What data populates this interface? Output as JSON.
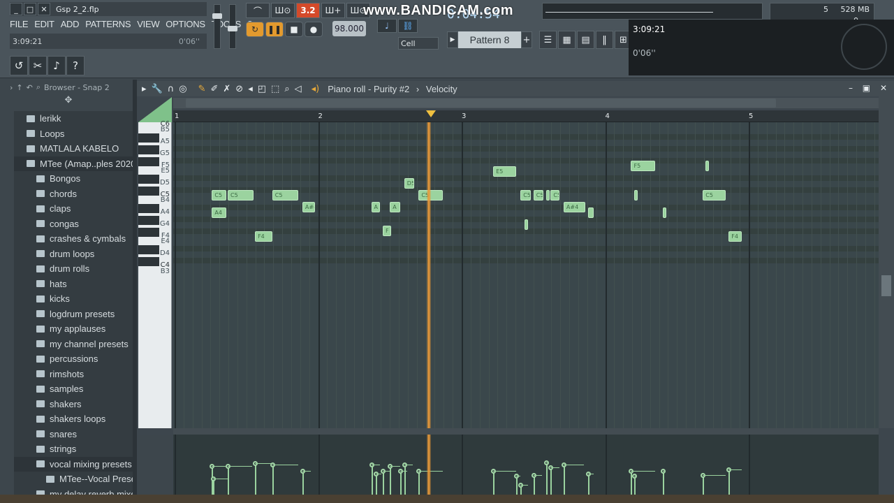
{
  "window": {
    "file_title": "Gsp 2_2.flp",
    "minimize_icon": "_",
    "restore_icon": "□",
    "close_icon": "✕"
  },
  "menu": [
    "FILE",
    "EDIT",
    "ADD",
    "PATTERNS",
    "VIEW",
    "OPTIONS",
    "TOOLS",
    "?"
  ],
  "hint": {
    "left": "3:09:21",
    "right": "0'06''"
  },
  "transport": {
    "buttons": [
      "⌒",
      "Ш⊙",
      "3.2",
      "Ш+",
      "Ш⊙",
      "↻",
      "❚❚",
      "■",
      "●"
    ],
    "tempo": "98.000",
    "time": "0:04:54"
  },
  "watermark": "www.BANDICAM.com",
  "snap": {
    "cell_label": "Cell"
  },
  "pattern": {
    "name": "Pattern 8",
    "prev_icon": "▶",
    "add_icon": "+"
  },
  "monitor": {
    "cpu": "5",
    "ram": "528 MB",
    "poly": "0"
  },
  "overlay": {
    "time": "3:09:21",
    "elapsed": "0'06''"
  },
  "browser": {
    "header": "Browser - Snap 2",
    "items": [
      {
        "label": "lerikk",
        "level": 1
      },
      {
        "label": "Loops",
        "level": 1
      },
      {
        "label": "MATLALA KABELO",
        "level": 1
      },
      {
        "label": "MTee (Amap..ples 2020",
        "level": 1,
        "selected": true
      },
      {
        "label": "Bongos",
        "level": 2
      },
      {
        "label": "chords",
        "level": 2
      },
      {
        "label": "claps",
        "level": 2
      },
      {
        "label": "congas",
        "level": 2
      },
      {
        "label": "crashes & cymbals",
        "level": 2
      },
      {
        "label": "drum loops",
        "level": 2
      },
      {
        "label": "drum rolls",
        "level": 2
      },
      {
        "label": "hats",
        "level": 2
      },
      {
        "label": "kicks",
        "level": 2
      },
      {
        "label": "logdrum presets",
        "level": 2
      },
      {
        "label": "my applauses",
        "level": 2
      },
      {
        "label": "my channel presets",
        "level": 2
      },
      {
        "label": "percussions",
        "level": 2
      },
      {
        "label": "rimshots",
        "level": 2
      },
      {
        "label": "samples",
        "level": 2
      },
      {
        "label": "shakers",
        "level": 2
      },
      {
        "label": "shakers loops",
        "level": 2
      },
      {
        "label": "snares",
        "level": 2
      },
      {
        "label": "strings",
        "level": 2
      },
      {
        "label": "vocal mixing presets",
        "level": 2,
        "selected": true
      },
      {
        "label": "MTee--Vocal Presets",
        "level": 3
      },
      {
        "label": "my delay reverb mixer",
        "level": 2
      }
    ]
  },
  "piano_roll": {
    "title": "Piano roll - Purity #2",
    "target": "Velocity",
    "bars": [
      "1",
      "2",
      "3",
      "4",
      "5"
    ],
    "key_labels": [
      "C6",
      "B5",
      "A5",
      "G5",
      "F5",
      "E5",
      "D5",
      "C5",
      "B4",
      "A4",
      "G4",
      "F4",
      "E4",
      "D4",
      "C4",
      "B3"
    ],
    "playhead_bar": 2.77,
    "colors": {
      "note": "#9bd39f",
      "playhead": "#e99a3a",
      "grid": "#3a474b"
    },
    "notes": [
      {
        "label": "C5",
        "key": "C5",
        "start": 1.26,
        "len": 0.1
      },
      {
        "label": "C5",
        "key": "C5",
        "start": 1.37,
        "len": 0.18
      },
      {
        "label": "C5",
        "key": "C5",
        "start": 1.68,
        "len": 0.18
      },
      {
        "label": "A4",
        "key": "A4",
        "start": 1.26,
        "len": 0.1
      },
      {
        "label": "F4",
        "key": "F4",
        "start": 1.56,
        "len": 0.12
      },
      {
        "label": "A#4",
        "key": "A#4",
        "start": 1.89,
        "len": 0.09
      },
      {
        "label": "A",
        "key": "A#4",
        "start": 2.37,
        "len": 0.06
      },
      {
        "label": "A",
        "key": "A#4",
        "start": 2.5,
        "len": 0.07
      },
      {
        "label": "F",
        "key": "F#4",
        "start": 2.45,
        "len": 0.06
      },
      {
        "label": "D5",
        "key": "D5",
        "start": 2.6,
        "len": 0.07
      },
      {
        "label": "C5",
        "key": "C5",
        "start": 2.7,
        "len": 0.17
      },
      {
        "label": "E5",
        "key": "E5",
        "start": 3.22,
        "len": 0.16
      },
      {
        "label": "C5",
        "key": "C5",
        "start": 3.41,
        "len": 0.07
      },
      {
        "label": "C5",
        "key": "C5",
        "start": 3.5,
        "len": 0.07
      },
      {
        "label": "",
        "key": "C5",
        "start": 3.59,
        "len": 0.02
      },
      {
        "label": "C5",
        "key": "C5",
        "start": 3.62,
        "len": 0.06
      },
      {
        "label": "",
        "key": "G4",
        "start": 3.44,
        "len": 0.02
      },
      {
        "label": "A#4",
        "key": "A#4",
        "start": 3.71,
        "len": 0.15
      },
      {
        "label": "",
        "key": "A4",
        "start": 3.88,
        "len": 0.04
      },
      {
        "label": "",
        "key": "C5",
        "start": 4.2,
        "len": 0.02
      },
      {
        "label": "F5",
        "key": "F5",
        "start": 4.18,
        "len": 0.17
      },
      {
        "label": "",
        "key": "A4",
        "start": 4.4,
        "len": 0.02
      },
      {
        "label": "",
        "key": "F5",
        "start": 4.7,
        "len": 0.01
      },
      {
        "label": "C5",
        "key": "C5",
        "start": 4.68,
        "len": 0.16
      },
      {
        "label": "F4",
        "key": "F4",
        "start": 4.86,
        "len": 0.09
      }
    ],
    "velocities": [
      {
        "pos": 1.26,
        "level": 0.5,
        "len": 0.1
      },
      {
        "pos": 1.27,
        "level": 0.3,
        "len": 0.1
      },
      {
        "pos": 1.37,
        "level": 0.5,
        "len": 0.17
      },
      {
        "pos": 1.56,
        "level": 0.55,
        "len": 0.12
      },
      {
        "pos": 1.68,
        "level": 0.52,
        "len": 0.18
      },
      {
        "pos": 1.89,
        "level": 0.42,
        "len": 0.06
      },
      {
        "pos": 2.37,
        "level": 0.52,
        "len": 0.06
      },
      {
        "pos": 2.4,
        "level": 0.38,
        "len": 0.04
      },
      {
        "pos": 2.45,
        "level": 0.42,
        "len": 0.06
      },
      {
        "pos": 2.5,
        "level": 0.5,
        "len": 0.07
      },
      {
        "pos": 2.57,
        "level": 0.42,
        "len": 0.05
      },
      {
        "pos": 2.6,
        "level": 0.52,
        "len": 0.06
      },
      {
        "pos": 2.7,
        "level": 0.42,
        "len": 0.17
      },
      {
        "pos": 3.22,
        "level": 0.42,
        "len": 0.16
      },
      {
        "pos": 3.38,
        "level": 0.35,
        "len": 0.03
      },
      {
        "pos": 3.41,
        "level": 0.2,
        "len": 0.05
      },
      {
        "pos": 3.5,
        "level": 0.36,
        "len": 0.06
      },
      {
        "pos": 3.59,
        "level": 0.56,
        "len": 0.02
      },
      {
        "pos": 3.62,
        "level": 0.48,
        "len": 0.06
      },
      {
        "pos": 3.71,
        "level": 0.52,
        "len": 0.14
      },
      {
        "pos": 3.88,
        "level": 0.38,
        "len": 0.04
      },
      {
        "pos": 4.18,
        "level": 0.42,
        "len": 0.17
      },
      {
        "pos": 4.2,
        "level": 0.34,
        "len": 0.02
      },
      {
        "pos": 4.4,
        "level": 0.42,
        "len": 0.02
      },
      {
        "pos": 4.68,
        "level": 0.36,
        "len": 0.16
      },
      {
        "pos": 4.86,
        "level": 0.45,
        "len": 0.09
      }
    ]
  }
}
